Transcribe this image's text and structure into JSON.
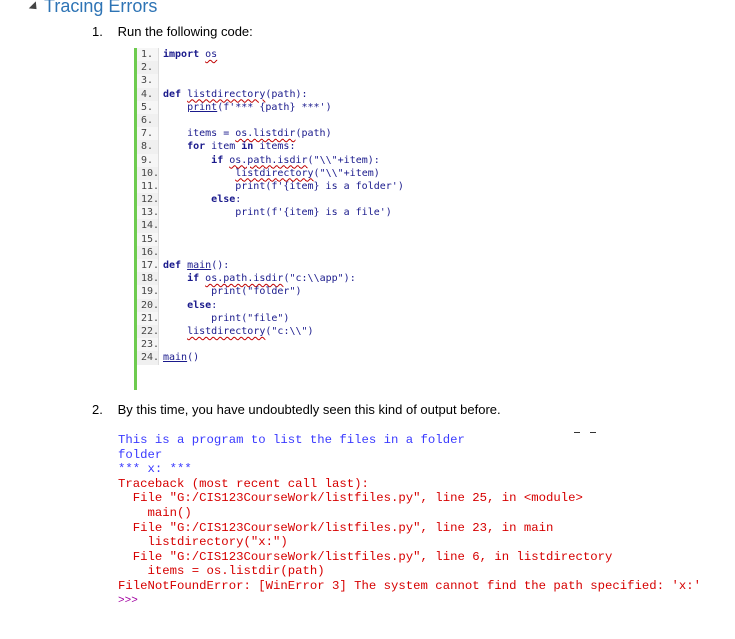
{
  "heading": "Tracing Errors",
  "steps": [
    {
      "num": "1.",
      "text": "Run the following code:"
    },
    {
      "num": "2.",
      "text": "By this time, you have undoubtedly seen this kind of output before."
    }
  ],
  "code_lines": [
    {
      "ln": "1.",
      "html": "<span class='kw'>import</span> <span class='squiggle'>os</span>"
    },
    {
      "ln": "2.",
      "html": ""
    },
    {
      "ln": "3.",
      "html": ""
    },
    {
      "ln": "4.",
      "html": "<span class='kw'>def</span> <span class='squiggle'>listdirectory</span>(path):"
    },
    {
      "ln": "5.",
      "html": "    <span class='ul'>print</span>(f<span class='str'>'*** {path} ***'</span>)"
    },
    {
      "ln": "6.",
      "html": ""
    },
    {
      "ln": "7.",
      "html": "    items = <span class='squiggle'>os.listdir</span>(path)"
    },
    {
      "ln": "8.",
      "html": "    <span class='kw'>for</span> item <span class='kw'>in</span> items:"
    },
    {
      "ln": "9.",
      "html": "        <span class='kw'>if</span> <span class='squiggle'>os.path.isdir</span>(<span class='str'>\"\\\\\"</span>+item):"
    },
    {
      "ln": "10.",
      "html": "            <span class='squiggle'>listdirectory</span>(<span class='str'>\"\\\\\"</span>+item)"
    },
    {
      "ln": "11.",
      "html": "            print(f<span class='str'>'{item} is a folder'</span>)"
    },
    {
      "ln": "12.",
      "html": "        <span class='kw'>else</span>:"
    },
    {
      "ln": "13.",
      "html": "            print(f<span class='str'>'{item} is a file'</span>)"
    },
    {
      "ln": "14.",
      "html": ""
    },
    {
      "ln": "15.",
      "html": ""
    },
    {
      "ln": "16.",
      "html": ""
    },
    {
      "ln": "17.",
      "html": "<span class='kw'>def</span> <span class='ul'>main</span>():"
    },
    {
      "ln": "18.",
      "html": "    <span class='kw'>if</span> <span class='squiggle'>os.path.isdir</span>(<span class='str'>\"c:\\\\app\"</span>):"
    },
    {
      "ln": "19.",
      "html": "        print(<span class='str'>\"folder\"</span>)"
    },
    {
      "ln": "20.",
      "html": "    <span class='kw'>else</span>:"
    },
    {
      "ln": "21.",
      "html": "        print(<span class='str'>\"file\"</span>)"
    },
    {
      "ln": "22.",
      "html": "    <span class='squiggle'>listdirectory</span>(<span class='str'>\"c:\\\\\"</span>)"
    },
    {
      "ln": "23.",
      "html": ""
    },
    {
      "ln": "24.",
      "html": "<span class='ul'>main</span>()"
    }
  ],
  "output_lines": [
    {
      "cls": "blue",
      "text": "This is a program to list the files in a folder"
    },
    {
      "cls": "blue",
      "text": "folder"
    },
    {
      "cls": "blue",
      "text": "*** x: ***"
    },
    {
      "cls": "red",
      "text": "Traceback (most recent call last):"
    },
    {
      "cls": "red",
      "text": "  File \"G:/CIS123CourseWork/listfiles.py\", line 25, in <module>"
    },
    {
      "cls": "red",
      "text": "    main()"
    },
    {
      "cls": "red",
      "text": "  File \"G:/CIS123CourseWork/listfiles.py\", line 23, in main"
    },
    {
      "cls": "red",
      "text": "    listdirectory(\"x:\")"
    },
    {
      "cls": "red",
      "text": "  File \"G:/CIS123CourseWork/listfiles.py\", line 6, in listdirectory"
    },
    {
      "cls": "red",
      "text": "    items = os.listdir(path)"
    },
    {
      "cls": "red",
      "text": "FileNotFoundError: [WinError 3] The system cannot find the path specified: 'x:'"
    },
    {
      "cls": "prompt",
      "text": ">>>"
    }
  ]
}
